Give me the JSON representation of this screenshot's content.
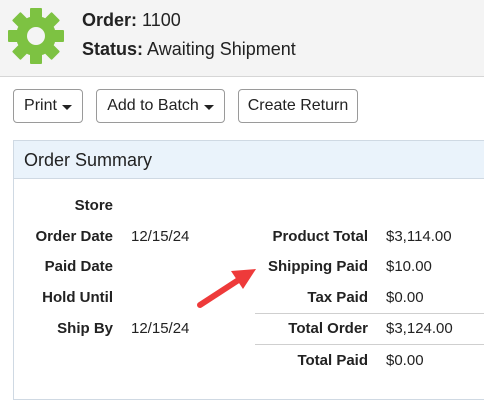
{
  "header": {
    "order_label": "Order:",
    "order_value": "1100",
    "status_label": "Status:",
    "status_value": "Awaiting Shipment",
    "icon": "gear-icon",
    "icon_color": "#7dc242"
  },
  "toolbar": {
    "print_label": "Print",
    "add_to_batch_label": "Add to Batch",
    "create_return_label": "Create Return"
  },
  "summary": {
    "title": "Order Summary",
    "left": {
      "store_label": "Store",
      "store_value": "",
      "order_date_label": "Order Date",
      "order_date_value": "12/15/24",
      "paid_date_label": "Paid Date",
      "paid_date_value": "",
      "hold_until_label": "Hold Until",
      "hold_until_value": "",
      "ship_by_label": "Ship By",
      "ship_by_value": "12/15/24"
    },
    "right": {
      "product_total_label": "Product Total",
      "product_total_value": "$3,114.00",
      "shipping_paid_label": "Shipping Paid",
      "shipping_paid_value": "$10.00",
      "tax_paid_label": "Tax Paid",
      "tax_paid_value": "$0.00",
      "total_order_label": "Total Order",
      "total_order_value": "$3,124.00",
      "total_paid_label": "Total Paid",
      "total_paid_value": "$0.00"
    }
  },
  "annotation": {
    "arrow_color": "#ee3a3a",
    "icon": "red-arrow-icon"
  }
}
